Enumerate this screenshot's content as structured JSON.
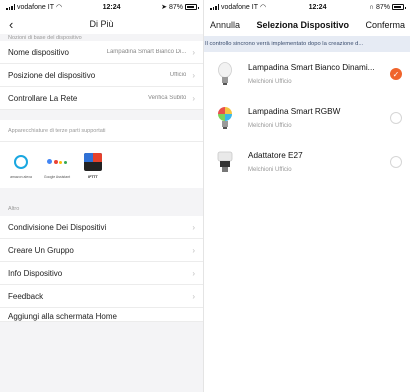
{
  "left": {
    "status": {
      "carrier": "vodafone IT",
      "time": "12:24",
      "battery": "87%"
    },
    "nav": {
      "title": "Di Più"
    },
    "section_basic": "Nozioni di base del dispositivo",
    "rows_basic": [
      {
        "label": "Nome dispositivo",
        "value": "Lampadina Smart Bianco Di..."
      },
      {
        "label": "Posizione del dispositivo",
        "value": "Ufficio"
      },
      {
        "label": "Controllare La Rete",
        "value": "Verifica Subito"
      }
    ],
    "section_third_party": "Apparecchiature di terze parti supportati",
    "third_party": [
      {
        "caption": "amazon alexa",
        "icon": "alexa-icon"
      },
      {
        "caption": "Google Assistant",
        "icon": "google-assistant-icon"
      },
      {
        "caption": "IFTTT",
        "icon": "ifttt-icon"
      }
    ],
    "section_other": "Altro",
    "rows_other": [
      {
        "label": "Condivisione Dei Dispositivi"
      },
      {
        "label": "Creare Un Gruppo"
      },
      {
        "label": "Info Dispositivo"
      },
      {
        "label": "Feedback"
      },
      {
        "label": "Aggiungi alla schermata Home"
      }
    ]
  },
  "right": {
    "status": {
      "carrier": "vodafone IT",
      "time": "12:24",
      "battery": "87%"
    },
    "nav": {
      "cancel": "Annulla",
      "title": "Seleziona Dispositivo",
      "confirm": "Conferma"
    },
    "notice": "Il controllo sincrono verrà implementato dopo la creazione d...",
    "devices": [
      {
        "name": "Lampadina Smart Bianco Dinami...",
        "room": "Melchioni Ufficio",
        "selected": true,
        "icon": "white-bulb-icon"
      },
      {
        "name": "Lampadina Smart RGBW",
        "room": "Melchioni Ufficio",
        "selected": false,
        "icon": "rgbw-bulb-icon"
      },
      {
        "name": "Adattatore E27",
        "room": "Melchioni Ufficio",
        "selected": false,
        "icon": "e27-adapter-icon"
      }
    ]
  },
  "colors": {
    "accent": "#f0642c",
    "notice_bg": "#e6ebf4",
    "page_bg": "#f4f4f6"
  }
}
